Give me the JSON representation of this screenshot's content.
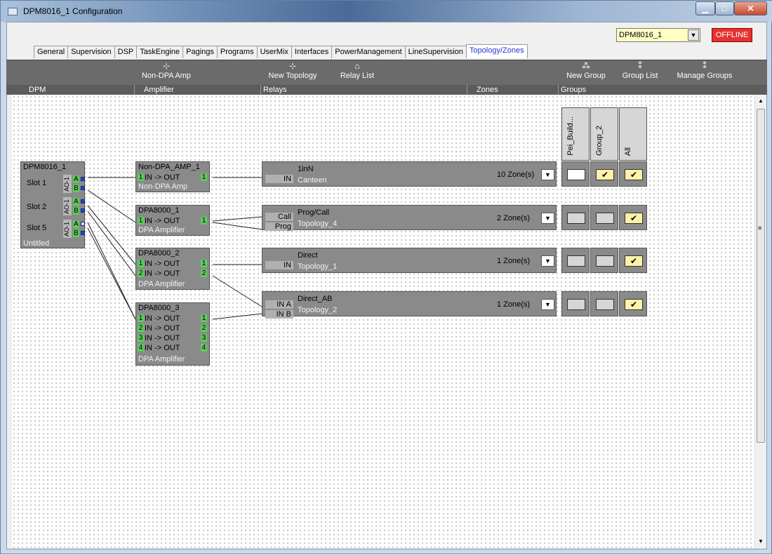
{
  "window": {
    "title": "DPM8016_1 Configuration",
    "device": "DPM8016_1",
    "status": "OFFLINE",
    "status_color": "#e73232"
  },
  "tabs": [
    "General",
    "Supervision",
    "DSP",
    "TaskEngine",
    "Pagings",
    "Programs",
    "UserMix",
    "Interfaces",
    "PowerManagement",
    "LineSupervision",
    "Topology/Zones"
  ],
  "active_tab": "Topology/Zones",
  "toolbar": {
    "non_dpa_amp": "Non-DPA Amp",
    "new_topology": "New Topology",
    "relay_list": "Relay List",
    "new_group": "New Group",
    "group_list": "Group List",
    "manage_groups": "Manage Groups"
  },
  "columns": {
    "dpm": "DPM",
    "amplifier": "Amplifier",
    "relays": "Relays",
    "zones": "Zones",
    "groups": "Groups"
  },
  "dpm": {
    "name": "DPM8016_1",
    "slots": [
      "Slot 1",
      "Slot 2",
      "Slot 5"
    ],
    "slot_tag": "AO-1",
    "port_a": "A",
    "port_b": "B",
    "footer": "Untitled"
  },
  "amplifiers": [
    {
      "name": "Non-DPA_AMP_1",
      "type": "Non-DPA Amp",
      "channels": [
        "1"
      ]
    },
    {
      "name": "DPA8000_1",
      "type": "DPA Amplifier",
      "channels": [
        "1"
      ]
    },
    {
      "name": "DPA8000_2",
      "type": "DPA Amplifier",
      "channels": [
        "1",
        "2"
      ]
    },
    {
      "name": "DPA8000_3",
      "type": "DPA Amplifier",
      "channels": [
        "1",
        "2",
        "3",
        "4"
      ]
    }
  ],
  "amp_labels": {
    "in": "IN",
    "out": "OUT",
    "arrow": "->"
  },
  "relays": [
    {
      "name": "1inN",
      "topology": "Canteen",
      "inputs": [
        "IN"
      ],
      "zones": "10 Zone(s)"
    },
    {
      "name": "Prog/Call",
      "topology": "Topology_4",
      "inputs": [
        "Call",
        "Prog"
      ],
      "zones": "2 Zone(s)"
    },
    {
      "name": "Direct",
      "topology": "Topology_1",
      "inputs": [
        "IN"
      ],
      "zones": "1 Zone(s)"
    },
    {
      "name": "Direct_AB",
      "topology": "Topology_2",
      "inputs": [
        "IN A",
        "IN B"
      ],
      "zones": "1 Zone(s)"
    }
  ],
  "groups": [
    "Pei_Build...",
    "Group_2",
    "All"
  ],
  "group_membership": [
    [
      "empty",
      "checked",
      "checked"
    ],
    [
      "unchecked",
      "unchecked",
      "checked"
    ],
    [
      "unchecked",
      "unchecked",
      "checked"
    ],
    [
      "unchecked",
      "unchecked",
      "checked"
    ]
  ],
  "check_glyph": "✔"
}
